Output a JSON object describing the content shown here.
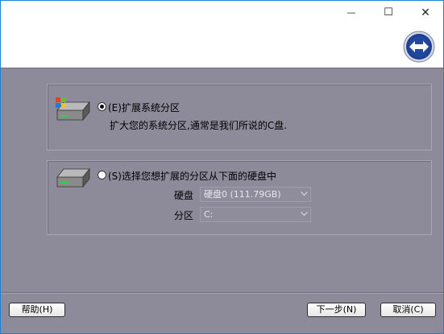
{
  "titlebar": {
    "minimize_glyph": "—",
    "maximize_glyph": "☐",
    "close_glyph": "✕"
  },
  "option_extend": {
    "label": "(E)扩展系统分区",
    "description": "扩大您的系统分区,通常是我们所说的C盘.",
    "selected": true
  },
  "option_select": {
    "label": "(S)选择您想扩展的分区从下面的硬盘中",
    "selected": false,
    "disk_label": "硬盘",
    "disk_value": "硬盘0 (111.79GB)",
    "partition_label": "分区",
    "partition_value": "C:"
  },
  "buttons": {
    "help": "帮助(H)",
    "next": "下一步(N)",
    "cancel": "取消(C)"
  },
  "icons": {
    "logo": "double-arrow-icon",
    "disk_windows": "windows-disk-icon",
    "disk": "disk-icon"
  },
  "colors": {
    "panel_bg": "#8d8a9a",
    "title_bg": "#ffffff",
    "logo_blue": "#1f3f8f"
  }
}
